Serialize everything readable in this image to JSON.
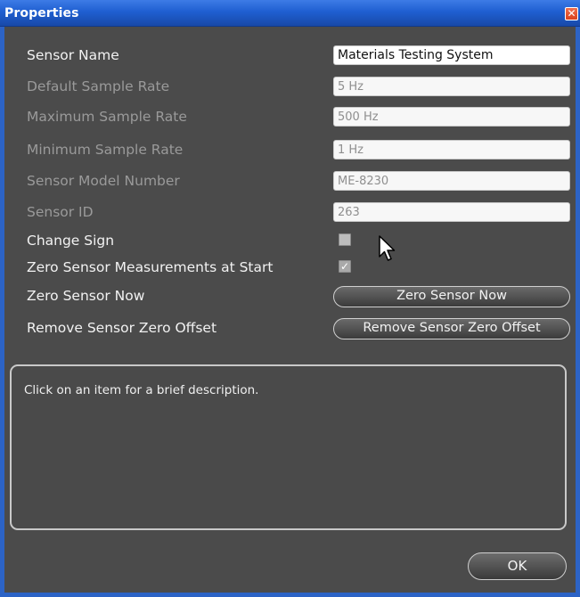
{
  "window": {
    "title": "Properties",
    "close_glyph": "✕",
    "close_icon": "close-icon",
    "colors": {
      "titlebar": "#1f5fd1",
      "frame": "#2c63c6",
      "background": "#4b4b4b",
      "close": "#d9411d"
    }
  },
  "properties": {
    "sensor_name": {
      "label": "Sensor Name",
      "value": "Materials Testing System"
    },
    "default_sample_rate": {
      "label": "Default Sample Rate",
      "value": "5 Hz"
    },
    "maximum_sample_rate": {
      "label": "Maximum Sample Rate",
      "value": "500 Hz"
    },
    "minimum_sample_rate": {
      "label": "Minimum Sample Rate",
      "value": "1 Hz"
    },
    "sensor_model_number": {
      "label": "Sensor Model Number",
      "value": "ME-8230"
    },
    "sensor_id": {
      "label": "Sensor ID",
      "value": "263"
    },
    "change_sign": {
      "label": "Change Sign",
      "checked": false
    },
    "zero_at_start": {
      "label": "Zero Sensor Measurements at Start",
      "checked": true,
      "check_glyph": "✓"
    },
    "zero_now": {
      "label": "Zero Sensor Now",
      "button": "Zero Sensor Now"
    },
    "remove_offset": {
      "label": "Remove Sensor Zero Offset",
      "button": "Remove Sensor Zero Offset"
    }
  },
  "description": {
    "text": "Click on an item for a brief description."
  },
  "footer": {
    "ok_label": "OK"
  },
  "cursor": {
    "icon": "mouse-pointer-icon"
  }
}
